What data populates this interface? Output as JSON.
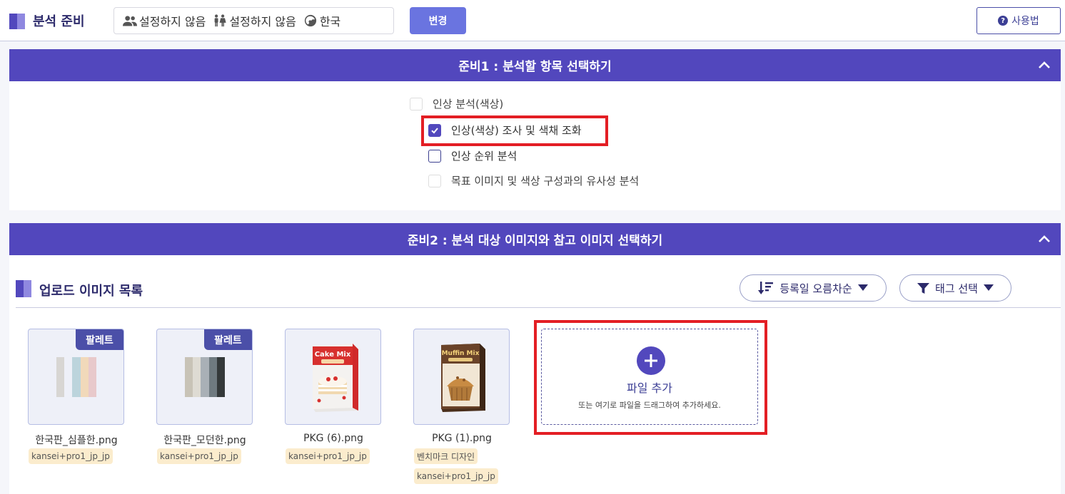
{
  "header": {
    "title": "분석 준비",
    "filters": [
      {
        "icon": "people-icon",
        "label": "설정하지 않음"
      },
      {
        "icon": "family-icon",
        "label": "설정하지 않음"
      },
      {
        "icon": "globe-icon",
        "label": "한국"
      }
    ],
    "change_label": "변경",
    "help_label": "사용법"
  },
  "step1": {
    "title": "준비1 : 분석할 항목 선택하기",
    "options": [
      {
        "label": "인상 분석(색상)",
        "checked": false,
        "enabled": false
      },
      {
        "label": "인상(색상) 조사 및 색채 조화",
        "checked": true,
        "enabled": true
      },
      {
        "label": "인상 순위 분석",
        "checked": false,
        "enabled": true
      },
      {
        "label": "목표 이미지 및 색상 구성과의 유사성 분석",
        "checked": false,
        "enabled": false
      }
    ]
  },
  "step2": {
    "title": "준비2 : 분석 대상 이미지와 참고 이미지 선택하기",
    "list_title": "업로드 이미지 목록",
    "sort_label": "등록일 오름차순",
    "tag_select_label": "태그 선택",
    "images": [
      {
        "name": "한국판_심플한.png",
        "badge": "팔레트",
        "tags": [
          "kansei+pro1_jp_jp"
        ],
        "palette": [
          "#d8d6d3",
          "#e9e5dd",
          "#bcd4dc",
          "#f1d9ba",
          "#e8c9cb"
        ]
      },
      {
        "name": "한국판_모던한.png",
        "badge": "팔레트",
        "tags": [
          "kansei+pro1_jp_jp"
        ],
        "palette": [
          "#c8c3b7",
          "#dedbd3",
          "#a9b0b6",
          "#6f7a80",
          "#34393a"
        ]
      },
      {
        "name": "PKG (6).png",
        "badge": "",
        "tags": [
          "kansei+pro1_jp_jp"
        ],
        "box_text": "Cake Mix"
      },
      {
        "name": "PKG (1).png",
        "badge": "",
        "tags": [
          "벤치마크 디자인",
          "kansei+pro1_jp_jp"
        ],
        "box_text": "Muffin Mix"
      }
    ],
    "drop": {
      "title": "파일 추가",
      "subtitle": "또는 여기로 파일을 드래그하여 추가하세요."
    }
  }
}
